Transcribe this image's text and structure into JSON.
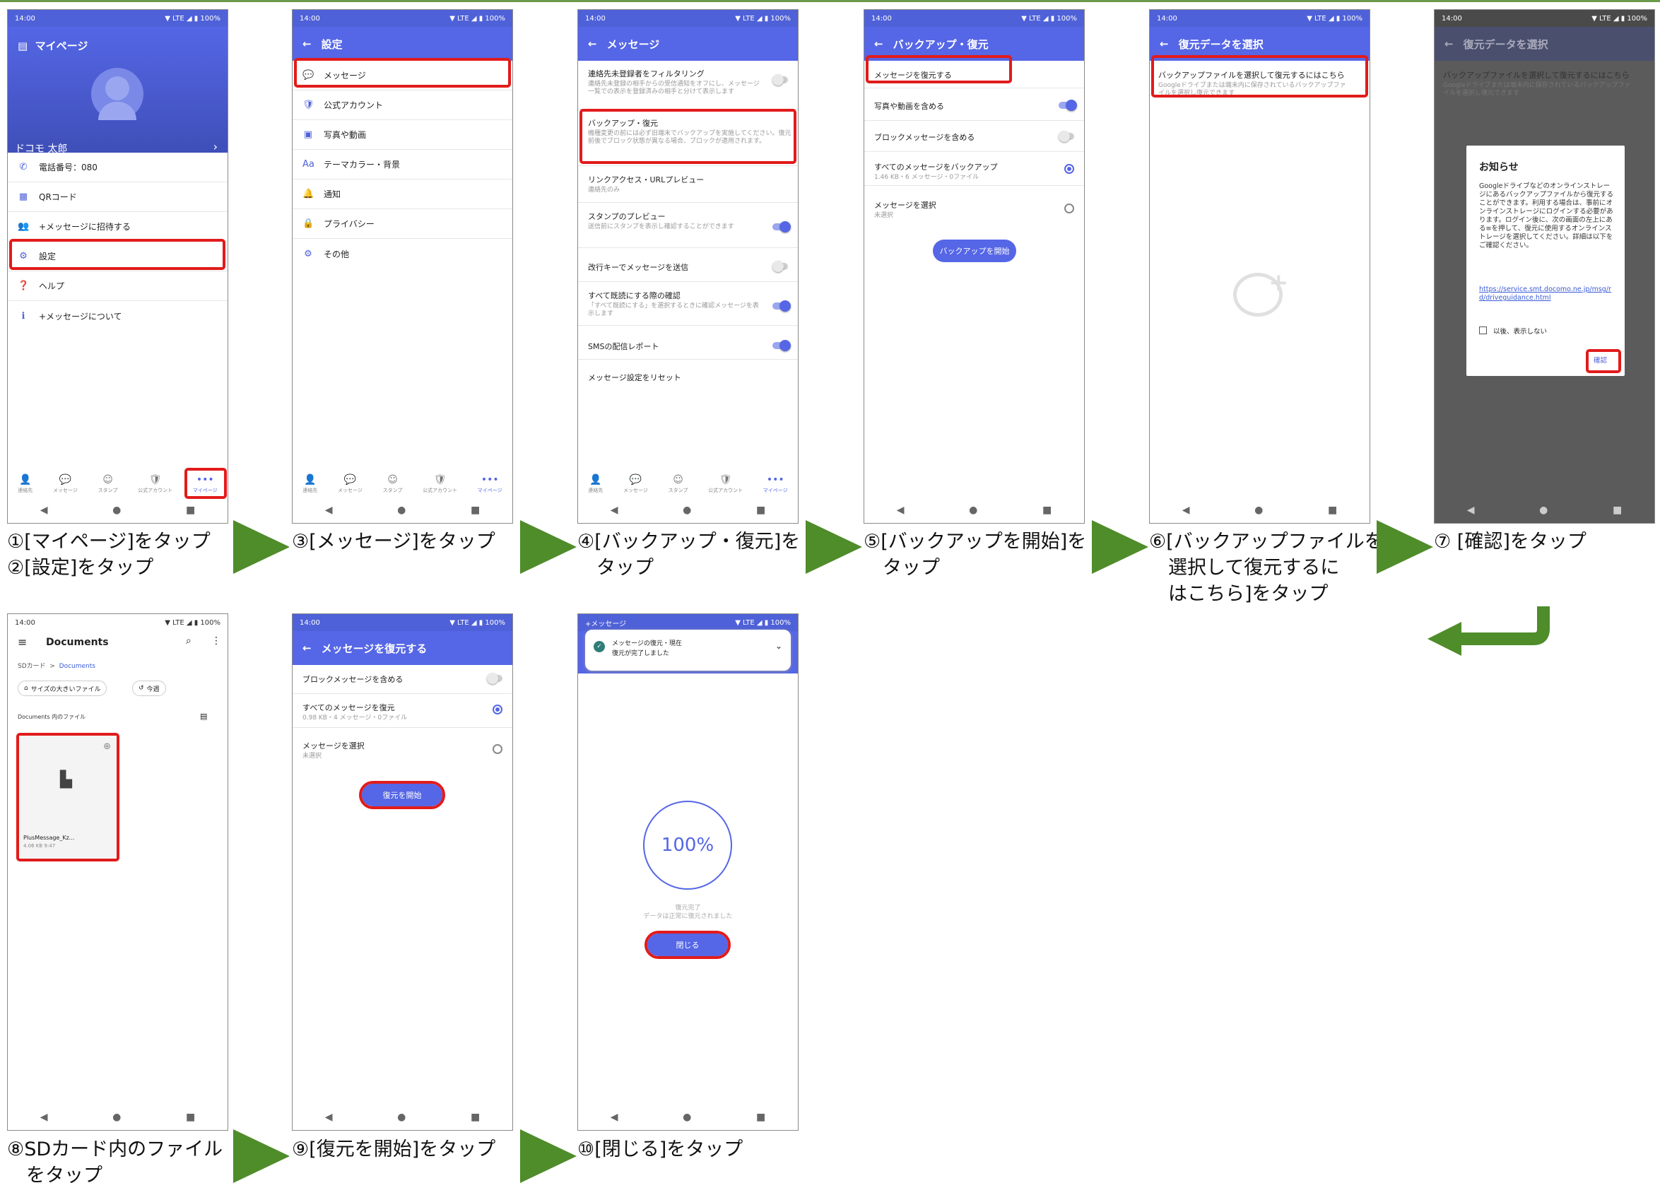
{
  "status": {
    "time": "14:00",
    "signal": "▼ LTE ◢ ▮ 100%"
  },
  "nav": {
    "back": "◀",
    "home": "●",
    "recent": "■"
  },
  "tabs": [
    {
      "label": "連絡先",
      "icon": "👤"
    },
    {
      "label": "メッセージ",
      "icon": "💬"
    },
    {
      "label": "スタンプ",
      "icon": "☺"
    },
    {
      "label": "公式アカウント",
      "icon": "🛡"
    },
    {
      "label": "マイページ",
      "icon": "•••"
    }
  ],
  "s1": {
    "title": "マイページ",
    "name": "ドコモ 太郎",
    "phone": "電話番号：080",
    "items": [
      "QRコード",
      "+メッセージに招待する",
      "設定",
      "ヘルプ",
      "+メッセージについて"
    ]
  },
  "s2": {
    "title": "設定",
    "items": [
      "メッセージ",
      "公式アカウント",
      "写真や動画",
      "テーマカラー・背景",
      "通知",
      "プライバシー",
      "その他"
    ]
  },
  "s3": {
    "title": "メッセージ",
    "items": [
      {
        "t": "連絡先未登録者をフィルタリング",
        "s": "連絡先未登録の相手からの受信通知をオフにし、メッセージ一覧での表示を登録済みの相手と分けて表示します"
      },
      {
        "t": "バックアップ・復元",
        "s": "機種変更の前には必ず旧端末でバックアップを実施してください。復元前後でブロック状態が異なる場合、ブロックが適用されます。"
      },
      {
        "t": "リンクアクセス・URLプレビュー",
        "s": "連絡先のみ"
      },
      {
        "t": "スタンプのプレビュー",
        "s": "送信前にスタンプを表示し確認することができます"
      },
      {
        "t": "改行キーでメッセージを送信",
        "s": ""
      },
      {
        "t": "すべて既読にする際の確認",
        "s": "「すべて既読にする」を選択するときに確認メッセージを表示します"
      },
      {
        "t": "SMSの配信レポート",
        "s": ""
      },
      {
        "t": "メッセージ設定をリセット",
        "s": ""
      }
    ]
  },
  "s4": {
    "title": "バックアップ・復元",
    "items": [
      {
        "t": "メッセージを復元する",
        "s": ""
      },
      {
        "t": "写真や動画を含める",
        "s": ""
      },
      {
        "t": "ブロックメッセージを含める",
        "s": ""
      },
      {
        "t": "すべてのメッセージをバックアップ",
        "s": "1.46 KB・6 メッセージ・0ファイル"
      },
      {
        "t": "メッセージを選択",
        "s": "未選択"
      }
    ],
    "button": "バックアップを開始"
  },
  "s5": {
    "title": "復元データを選択",
    "link": "バックアップファイルを選択して復元するにはこちら",
    "sub": "Googleドライブまたは端末内に保存されているバックアップファイルを選択し復元できます"
  },
  "s6": {
    "title": "復元データを選択",
    "link": "バックアップファイルを選択して復元するにはこちら",
    "sub": "Googleドライブまたは端末内に保存されているバックアップファイルを選択し復元できます",
    "dialog_title": "お知らせ",
    "dialog_body": "Googleドライブなどのオンラインストレージにあるバックアップファイルから復元することができます。利用する場合は、事前にオンラインストレージにログインする必要があります。ログイン後に、次の画面の左上にある≡を押して、復元に使用するオンラインストレージを選択してください。詳細は以下をご確認ください。",
    "dialog_link": "https://service.smt.docomo.ne.jp/msg/rd/driveguidance.html",
    "checkbox": "以後、表示しない",
    "confirm": "確認"
  },
  "s7": {
    "title": "Documents",
    "crumb1": "SDカード",
    "crumb2": "Documents",
    "chip1": "サイズの大きいファイル",
    "chip2": "今週",
    "section": "Documents 内のファイル",
    "file": "PlusMessage_Kz...",
    "filesub": "4.06 KB 9:47"
  },
  "s8": {
    "title": "メッセージを復元する",
    "items": [
      {
        "t": "ブロックメッセージを含める",
        "s": ""
      },
      {
        "t": "すべてのメッセージを復元",
        "s": "0.98 KB・4 メッセージ・0ファイル"
      },
      {
        "t": "メッセージを選択",
        "s": "未選択"
      }
    ],
    "button": "復元を開始"
  },
  "s9": {
    "status": "+メッセージ",
    "notif_title": "メッセージの復元・現在",
    "notif_body": "復元が完了しました",
    "percent": "100%",
    "done1": "復元完了",
    "done2": "データは正常に復元されました",
    "button": "閉じる"
  },
  "captions": {
    "c1": "①[マイページ]をタップ\n②[設定]をタップ",
    "c2": "③[メッセージ]をタップ",
    "c3": "④[バックアップ・復元]を\n　タップ",
    "c4": "⑤[バックアップを開始]を\n　タップ",
    "c5": "⑥[バックアップファイルを\n　選択して復元するに\n　はこちら]をタップ",
    "c6": "⑦ [確認]をタップ",
    "c7": "⑧SDカード内のファイル\n　をタップ",
    "c8": "⑨[復元を開始]をタップ",
    "c9": "⑩[閉じる]をタップ"
  }
}
